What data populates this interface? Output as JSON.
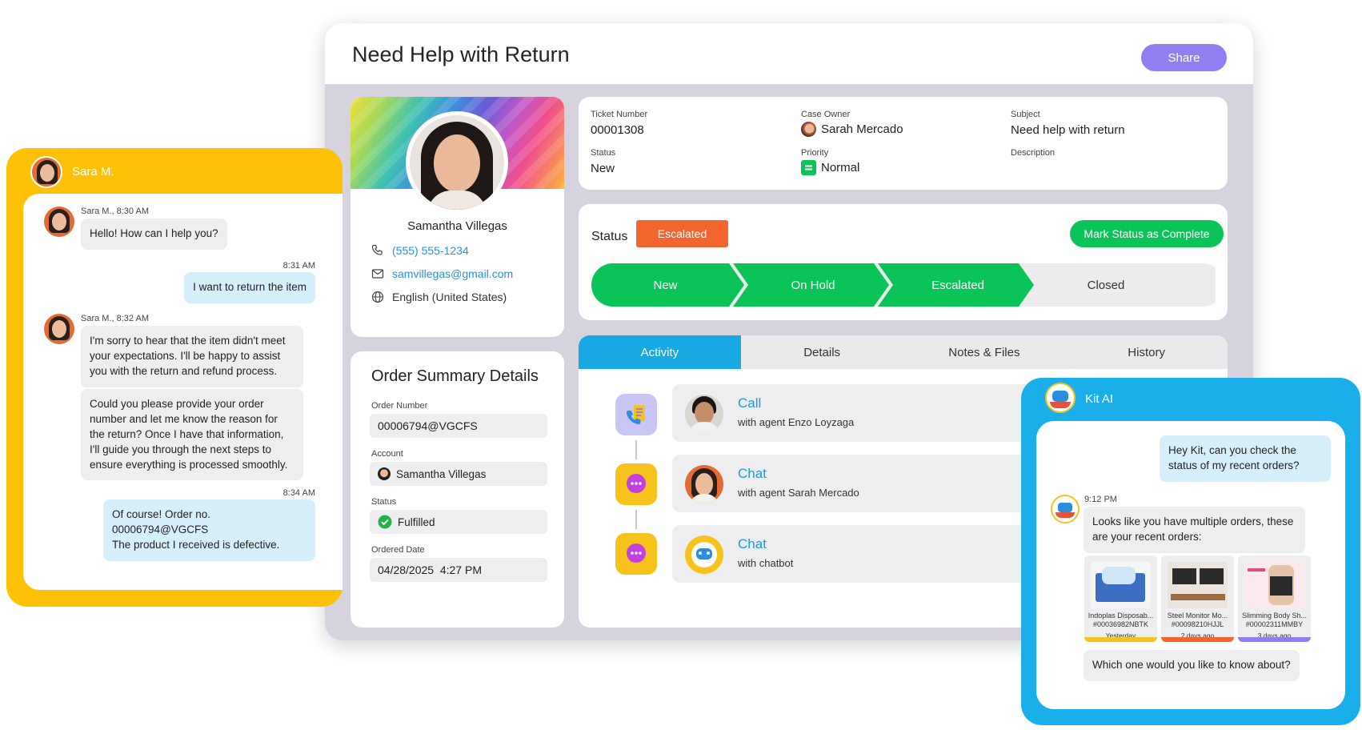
{
  "ticket": {
    "title": "Need Help with Return",
    "share_label": "Share",
    "info": {
      "ticket_number_label": "Ticket Number",
      "ticket_number": "00001308",
      "case_owner_label": "Case Owner",
      "case_owner": "Sarah Mercado",
      "subject_label": "Subject",
      "subject": "Need help with return",
      "status_label": "Status",
      "status": "New",
      "priority_label": "Priority",
      "priority": "Normal",
      "description_label": "Description"
    },
    "status_panel": {
      "label": "Status",
      "badge": "Escalated",
      "complete_button": "Mark Status as Complete",
      "stages": [
        "New",
        "On Hold",
        "Escalated",
        "Closed"
      ]
    }
  },
  "profile": {
    "name": "Samantha Villegas",
    "phone": "(555) 555-1234",
    "email": "samvillegas@gmail.com",
    "language": "English (United States)"
  },
  "order": {
    "title": "Order Summary Details",
    "order_number_label": "Order Number",
    "order_number": "00006794@VGCFS",
    "account_label": "Account",
    "account": "Samantha Villegas",
    "status_label": "Status",
    "status": "Fulfilled",
    "date_label": "Ordered Date",
    "date": "04/28/2025  4:27 PM"
  },
  "tabs": [
    "Activity",
    "Details",
    "Notes & Files",
    "History"
  ],
  "activities": [
    {
      "title": "Call",
      "sub": "with agent Enzo Loyzaga"
    },
    {
      "title": "Chat",
      "sub": "with agent Sarah Mercado"
    },
    {
      "title": "Chat",
      "sub": "with chatbot"
    }
  ],
  "sara_chat": {
    "header_name": "Sara M.",
    "messages": [
      {
        "meta": "Sara M., 8:30 AM",
        "text": "Hello! How can I help you?"
      },
      {
        "meta": "8:31 AM",
        "text": "I want to return the item"
      },
      {
        "meta": "Sara M., 8:32 AM",
        "text": "I'm sorry to hear that the item didn't meet your expectations. I'll be happy to assist you with the return and refund process."
      },
      {
        "text": "Could you please provide your order number and let me know the reason for the return? Once I have that information, I'll guide you through the next steps to ensure everything is processed smoothly."
      },
      {
        "meta": "8:34 AM",
        "text": "Of course! Order no. 00006794@VGCFS\nThe product I received is defective."
      }
    ]
  },
  "kit_chat": {
    "header_name": "Kit AI",
    "user_message": "Hey Kit, can you check the status of my recent orders?",
    "bot_time": "9:12 PM",
    "bot_message": "Looks like you have multiple orders, these are your recent orders:",
    "products": [
      {
        "name": "Indoplas Disposab...",
        "id": "#00036982NBTK",
        "when": "Yesterday",
        "color": "#f6c21b"
      },
      {
        "name": "Steel Monitor Mo...",
        "id": "#00098210HJJL",
        "when": "2 days ago",
        "color": "#f2652f"
      },
      {
        "name": "Slimming Body Sh...",
        "id": "#00002311MMBY",
        "when": "3 days ago",
        "color": "#8f7ff0"
      }
    ],
    "followup": "Which one would you like to know about?"
  },
  "colors": {
    "accent_blue": "#18a9e3",
    "share_purple": "#8f7ff0",
    "escalated_orange": "#f2652f",
    "success_green": "#0bc457",
    "sara_yellow": "#ffc107"
  }
}
